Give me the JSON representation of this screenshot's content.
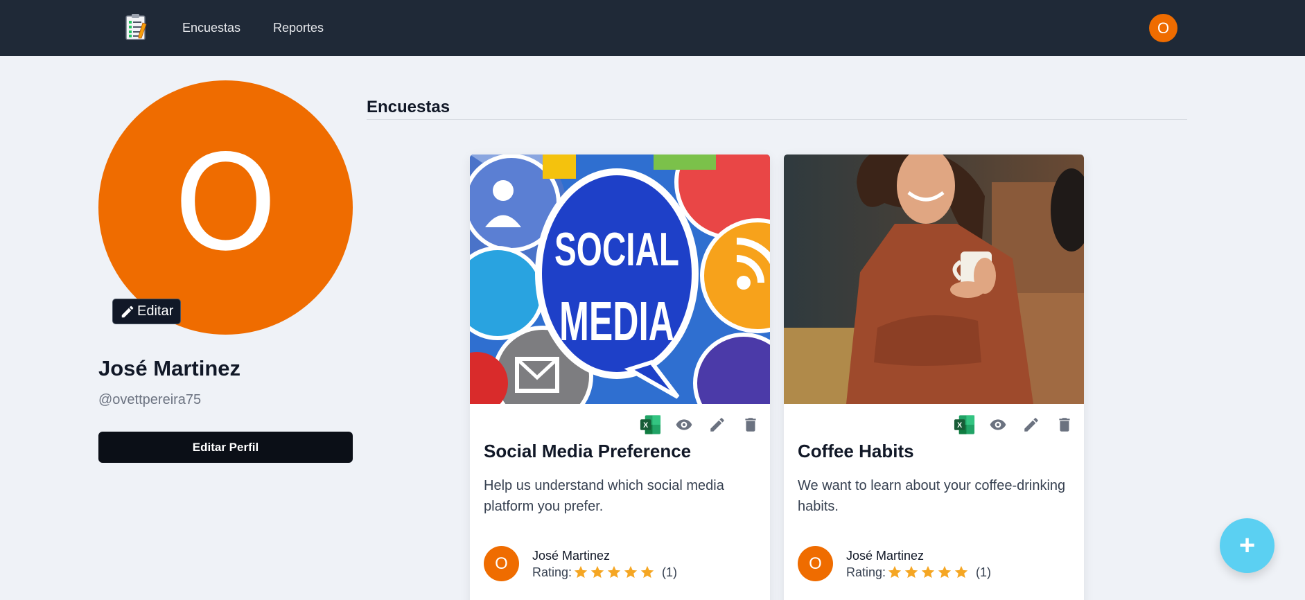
{
  "nav": {
    "logo_icon": "clipboard-checklist-icon",
    "links": [
      "Encuestas",
      "Reportes"
    ],
    "user_initial": "O"
  },
  "profile": {
    "initial": "O",
    "edit_photo_label": "Editar",
    "name": "José Martinez",
    "handle": "@ovettpereira75",
    "edit_profile_label": "Editar Perfil"
  },
  "section": {
    "title": "Encuestas"
  },
  "surveys": [
    {
      "image": "social-media-collage-image",
      "title": "Social Media Preference",
      "description": "Help us understand which social media platform you prefer.",
      "author_initial": "O",
      "author": "José Martinez",
      "rating_label": "Rating:",
      "rating": 5,
      "rating_count": "(1)",
      "image_text": [
        "SOCIAL",
        "MEDIA"
      ]
    },
    {
      "image": "woman-with-coffee-photo",
      "title": "Coffee Habits",
      "description": "We want to learn about your coffee-drinking habits.",
      "author_initial": "O",
      "author": "José Martinez",
      "rating_label": "Rating:",
      "rating": 5,
      "rating_count": "(1)"
    }
  ],
  "fab": {
    "label": "+"
  },
  "colors": {
    "nav_bg": "#1f2937",
    "accent": "#ef6c00",
    "star": "#f5a623",
    "fab": "#5bd0f2"
  }
}
